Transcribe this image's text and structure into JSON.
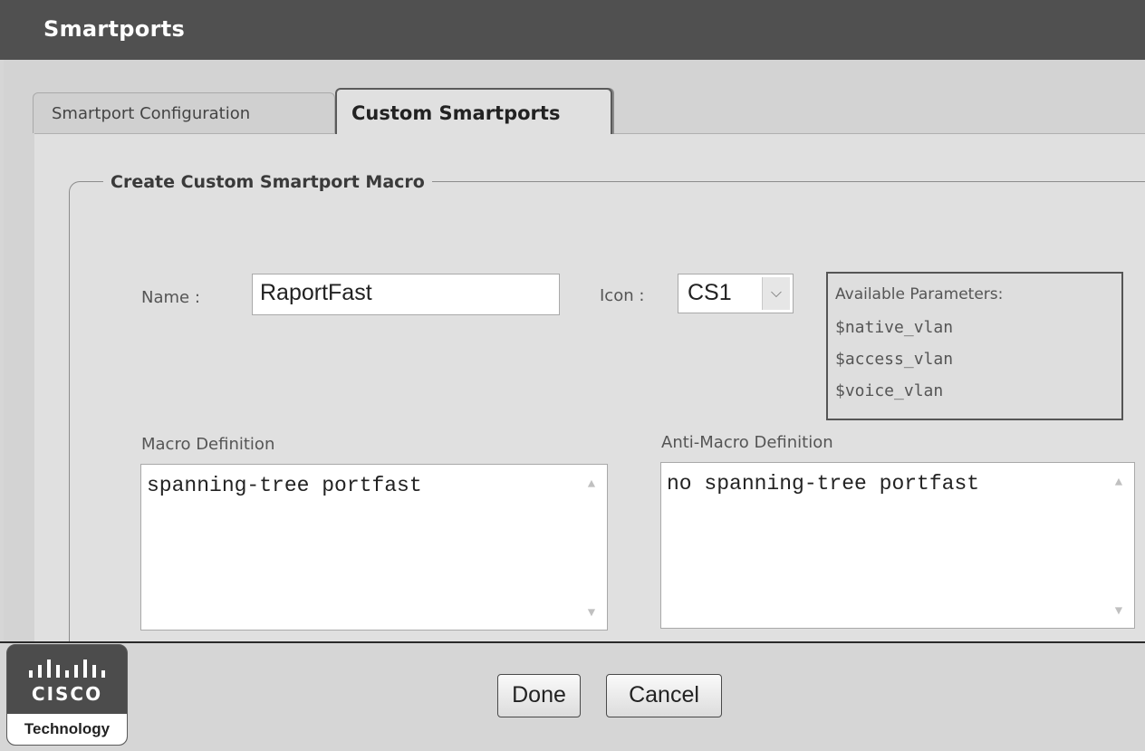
{
  "window": {
    "title": "Smartports"
  },
  "tabs": [
    {
      "label": "Smartport Configuration",
      "active": false
    },
    {
      "label": "Custom Smartports",
      "active": true
    }
  ],
  "form": {
    "legend": "Create Custom Smartport Macro",
    "name_label": "Name :",
    "name_value": "RaportFast",
    "icon_label": "Icon :",
    "icon_value": "CS1",
    "parameters": {
      "heading": "Available Parameters:",
      "items": [
        "$native_vlan",
        "$access_vlan",
        "$voice_vlan"
      ]
    },
    "macro_label": "Macro Definition",
    "macro_value": "spanning-tree portfast",
    "anti_macro_label": "Anti-Macro Definition",
    "anti_macro_value": "no spanning-tree portfast"
  },
  "footer": {
    "done_label": "Done",
    "cancel_label": "Cancel"
  },
  "logo": {
    "brand": "CISCO",
    "tagline": "Technology"
  },
  "colors": {
    "titlebar": "#505050",
    "panel": "#e0e0e0",
    "background": "#d6d6d6"
  }
}
